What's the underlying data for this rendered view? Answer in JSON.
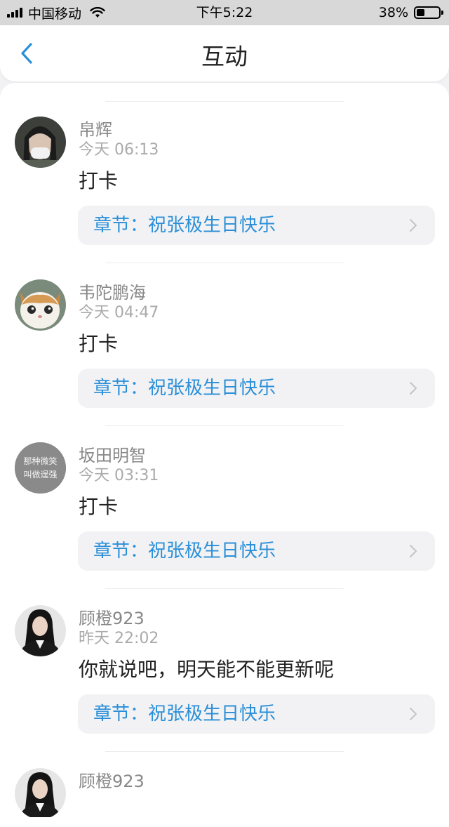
{
  "status_bar": {
    "carrier": "中国移动",
    "time": "下午5:22",
    "battery": "38%",
    "battery_level": 0.38
  },
  "nav": {
    "title": "互动",
    "back_icon": "chevron-left-icon"
  },
  "colors": {
    "accent": "#2a8fd8",
    "background": "#f2f2f4"
  },
  "comments": [
    {
      "name": "帛辉",
      "time": "今天 06:13",
      "text": "打卡",
      "chapter_prefix": "章节：",
      "chapter": "祝张极生日快乐",
      "avatar": "avatar-girl-mask"
    },
    {
      "name": "韦陀鹏海",
      "time": "今天 04:47",
      "text": "打卡",
      "chapter_prefix": "章节：",
      "chapter": "祝张极生日快乐",
      "avatar": "avatar-cat"
    },
    {
      "name": "坂田明智",
      "time": "今天 03:31",
      "text": "打卡",
      "chapter_prefix": "章节：",
      "chapter": "祝张极生日快乐",
      "avatar": "avatar-text",
      "avatar_text_1": "那种微笑",
      "avatar_text_2": "叫做逞强"
    },
    {
      "name": "顾橙923",
      "time": "昨天 22:02",
      "text": "你就说吧，明天能不能更新呢",
      "chapter_prefix": "章节：",
      "chapter": "祝张极生日快乐",
      "avatar": "avatar-woman"
    },
    {
      "name": "顾橙923",
      "time": "",
      "text": "",
      "avatar": "avatar-woman"
    }
  ]
}
